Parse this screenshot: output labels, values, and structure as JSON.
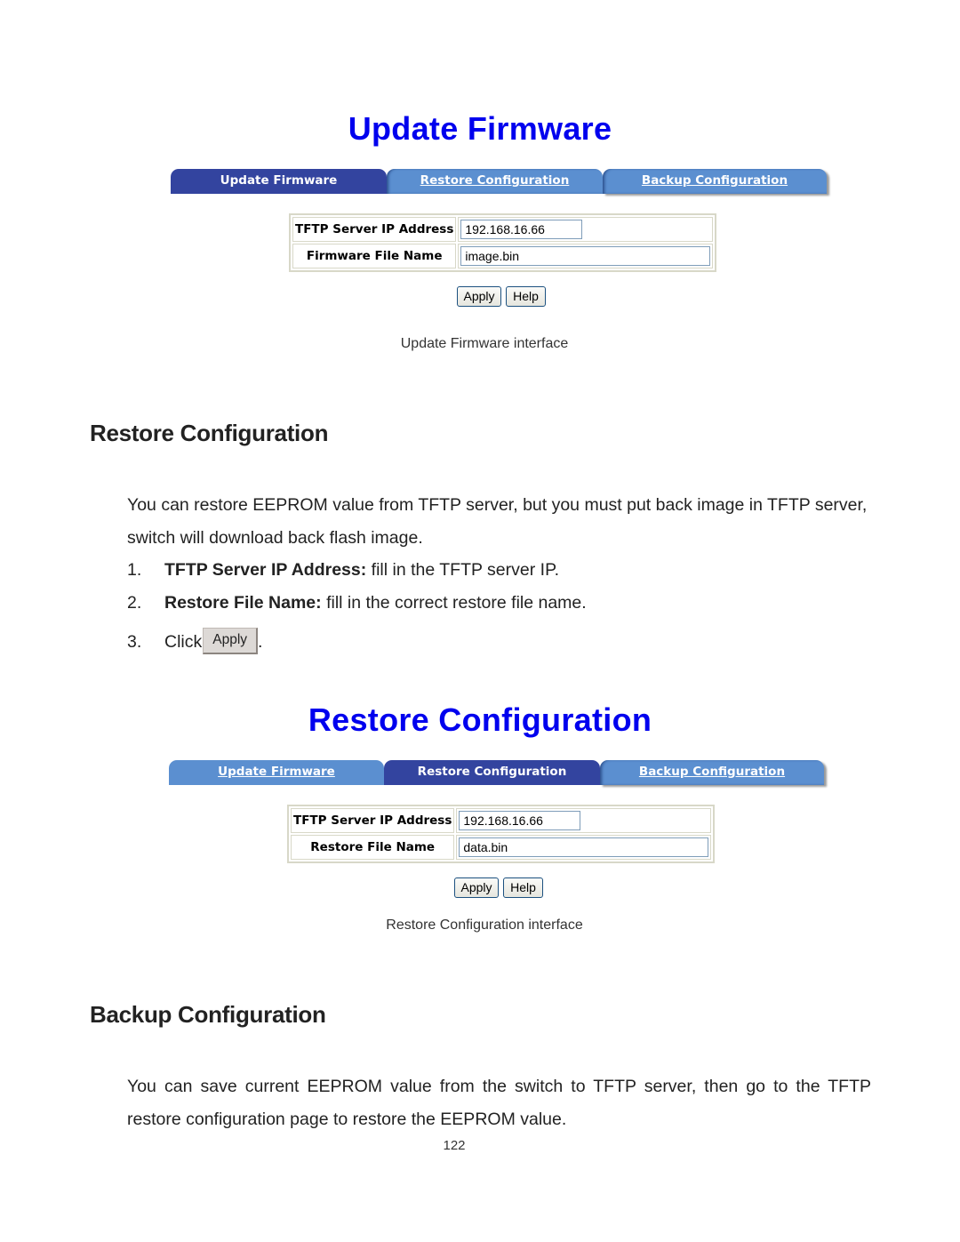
{
  "update_firmware_ui": {
    "title": "Update Firmware",
    "tabs": [
      {
        "label": "Update Firmware",
        "active": true
      },
      {
        "label": "Restore Configuration",
        "active": false
      },
      {
        "label": "Backup Configuration",
        "active": false
      }
    ],
    "fields": {
      "ip_label": "TFTP Server IP Address",
      "ip_value": "192.168.16.66",
      "file_label": "Firmware File Name",
      "file_value": "image.bin"
    },
    "apply_label": "Apply",
    "help_label": "Help",
    "caption": "Update Firmware interface"
  },
  "restore_section": {
    "heading": "Restore Configuration",
    "paragraph": "You can restore EEPROM value from TFTP server, but you must put back image in TFTP server, switch will download back flash image.",
    "steps": [
      {
        "num": "1.",
        "bold": "TFTP Server IP Address:",
        "text": " fill in the TFTP server IP."
      },
      {
        "num": "2.",
        "bold": "Restore File Name:",
        "text": " fill in the correct restore file name."
      },
      {
        "num": "3.",
        "text": "Click",
        "button": "Apply",
        "after": "."
      }
    ]
  },
  "restore_config_ui": {
    "title": "Restore Configuration",
    "tabs": [
      {
        "label": "Update Firmware",
        "active": false
      },
      {
        "label": "Restore Configuration",
        "active": true
      },
      {
        "label": "Backup Configuration",
        "active": false
      }
    ],
    "fields": {
      "ip_label": "TFTP Server IP Address",
      "ip_value": "192.168.16.66",
      "file_label": "Restore File Name",
      "file_value": "data.bin"
    },
    "apply_label": "Apply",
    "help_label": "Help",
    "caption": "Restore Configuration interface"
  },
  "backup_section": {
    "heading": "Backup Configuration",
    "paragraph": "You can save current EEPROM value from the switch to TFTP server, then go to the TFTP restore configuration page to restore the EEPROM value."
  },
  "page_number": "122",
  "colors": {
    "ui_title": "#0000ee",
    "tab_active": "#33449f",
    "tab_inactive": "#5b8fd0"
  }
}
